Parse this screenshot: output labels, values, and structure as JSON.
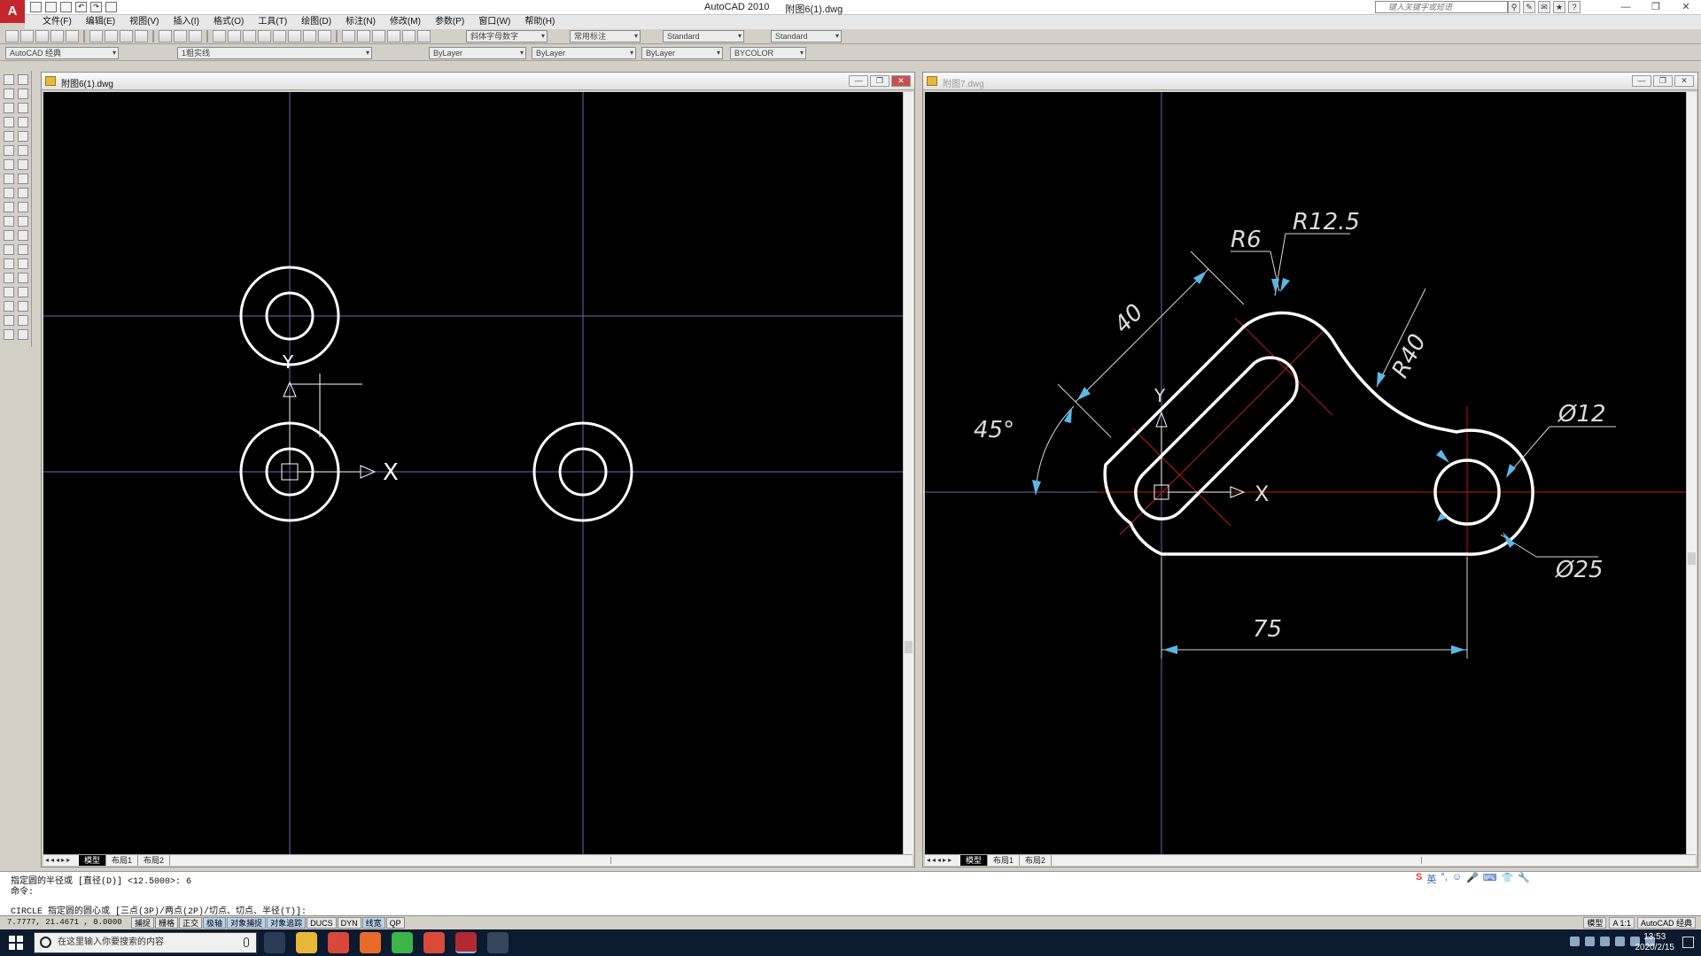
{
  "app": {
    "title": "AutoCAD 2010",
    "document": "附图6(1).dwg",
    "help_search_placeholder": "键入关键字或短语"
  },
  "menu": [
    "文件(F)",
    "编辑(E)",
    "视图(V)",
    "插入(I)",
    "格式(O)",
    "工具(T)",
    "绘图(D)",
    "标注(N)",
    "修改(M)",
    "参数(P)",
    "窗口(W)",
    "帮助(H)"
  ],
  "toolbar": {
    "text_style": "斜体字母数字",
    "dim_style": "常用标注",
    "table_style": "Standard",
    "mleader_style": "Standard",
    "workspace": "AutoCAD 经典",
    "layer": "1粗实线",
    "color": "ByLayer",
    "linetype": "ByLayer",
    "lineweight": "ByLayer",
    "plotstyle": "BYCOLOR"
  },
  "windows": {
    "left": {
      "title": "附图6(1).dwg",
      "tabs": [
        "模型",
        "布局1",
        "布局2"
      ]
    },
    "right": {
      "title": "附图7.dwg",
      "tabs": [
        "模型",
        "布局1",
        "布局2"
      ],
      "dims": {
        "r6": "R6",
        "r12_5": "R12.5",
        "len40": "40",
        "r40": "R40",
        "angle45": "45°",
        "dia12": "Ø12",
        "dia25": "Ø25",
        "len75": "75"
      }
    },
    "axis_x": "X",
    "axis_y": "Y"
  },
  "command": {
    "line1": "指定圆的半径或 [直径(D)] <12.5000>: 6",
    "line2": "命令:",
    "line3": "CIRCLE 指定圆的圆心或 [三点(3P)/两点(2P)/切点、切点、半径(T)]:"
  },
  "status": {
    "coords": "7.7777, 21.4671 , 0.0000",
    "toggles": [
      "捕捉",
      "栅格",
      "正交",
      "极轴",
      "对象捕捉",
      "对象追踪",
      "DUCS",
      "DYN",
      "线宽",
      "QP"
    ],
    "right": [
      "模型",
      "A 1:1",
      "AutoCAD 经典"
    ]
  },
  "taskbar": {
    "search_placeholder": "在这里输入你要搜索的内容",
    "time": "13:53",
    "date": "2020/2/15",
    "ime": "英"
  },
  "colors": {
    "dim_arrow": "#5bb8e6",
    "center_line": "#c01a1a",
    "grid_line": "#6b6ba8"
  }
}
